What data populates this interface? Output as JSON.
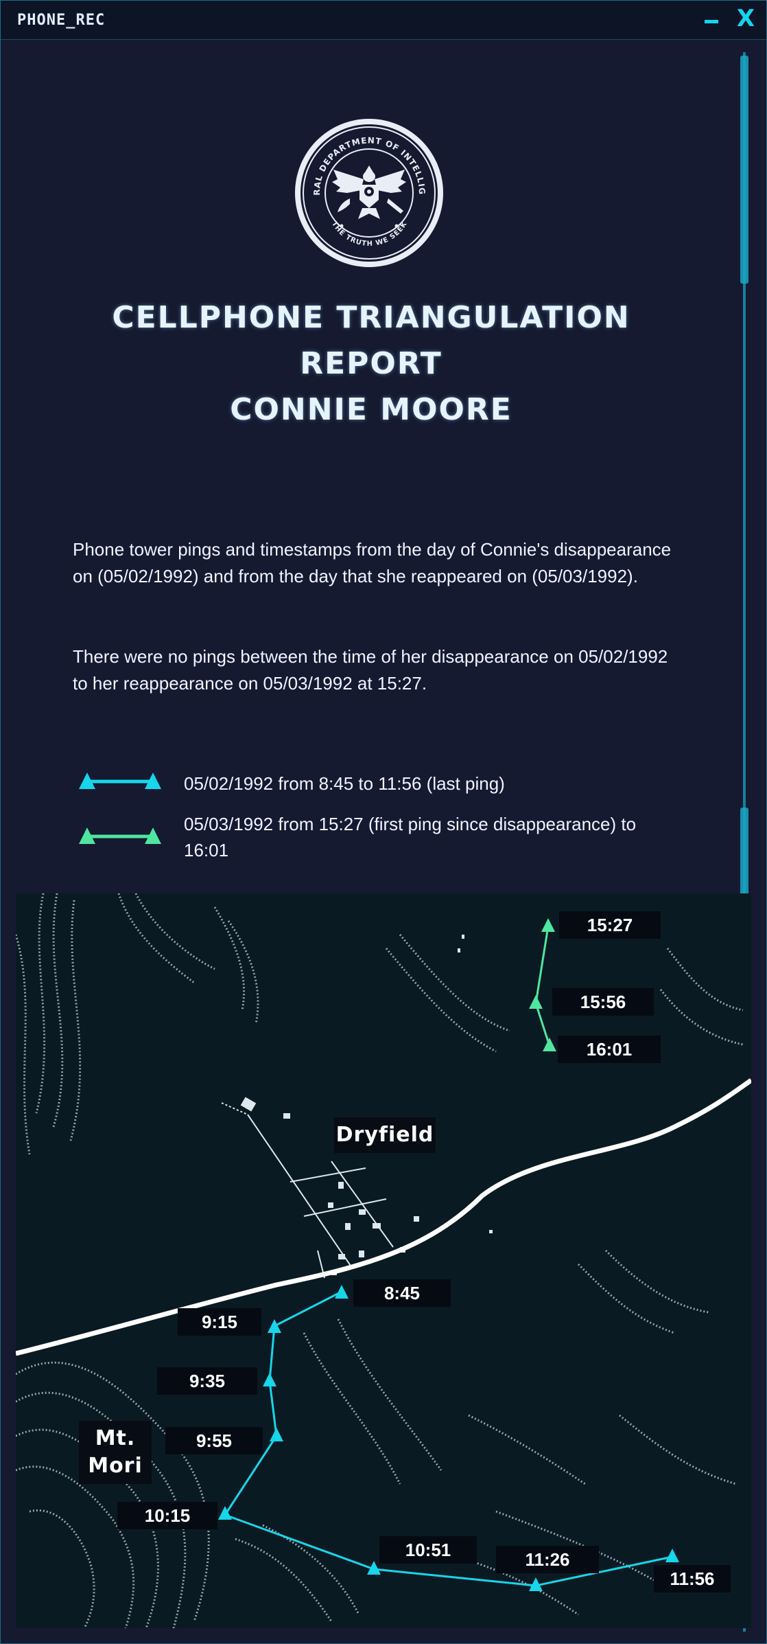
{
  "window": {
    "title": "PHONE_REC",
    "minimize_label": "-",
    "close_label": "X"
  },
  "seal": {
    "ring_top_text": "FEDERAL DEPARTMENT OF INTELLIGENCE",
    "ring_bottom_text": "THE TRUTH WE SEEK"
  },
  "report": {
    "title_line1": "CELLPHONE TRIANGULATION",
    "title_line2": "REPORT",
    "title_line3": "CONNIE MOORE",
    "paragraph1": "Phone tower pings and timestamps from the day of Connie's disappearance on (05/02/1992) and from the day that she reappeared on (05/03/1992).",
    "paragraph2": "There were no pings between the time of her disappearance on 05/02/1992 to her reappearance on 05/03/1992 at 15:27."
  },
  "legend": [
    {
      "text": "05/02/1992 from 8:45 to 11:56 (last ping)",
      "color": "#16d6ea"
    },
    {
      "text": "05/03/1992 from 15:27 (first ping since disappearance) to 16:01",
      "color": "#4ee6a0"
    }
  ],
  "map": {
    "places": {
      "town": "Dryfield",
      "mountain_line1": "Mt.",
      "mountain_line2": "Mori"
    },
    "day1_pings": [
      "8:45",
      "9:15",
      "9:35",
      "9:55",
      "10:15",
      "10:51",
      "11:26",
      "11:56"
    ],
    "day2_pings": [
      "15:27",
      "15:56",
      "16:01"
    ]
  }
}
